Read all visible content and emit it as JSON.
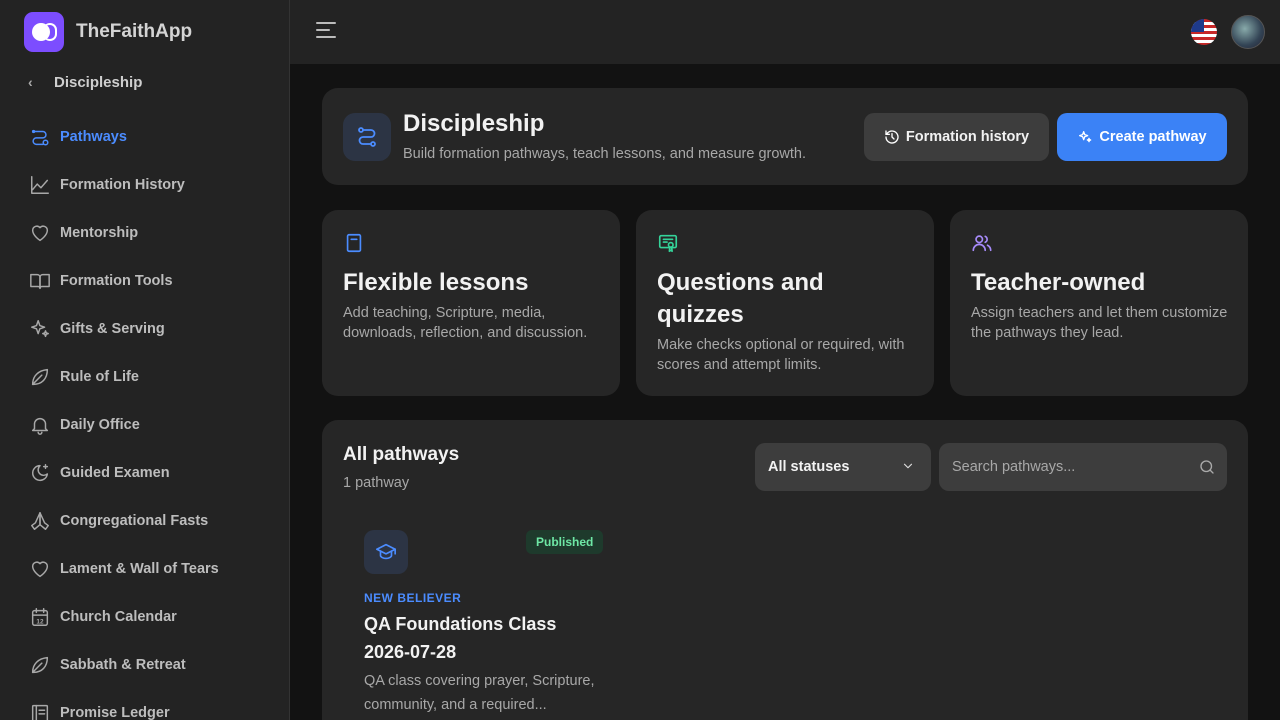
{
  "app": {
    "name": "TheFaithApp"
  },
  "sidebar": {
    "back_label": "Discipleship",
    "items": [
      {
        "label": "Pathways",
        "icon": "route-icon",
        "active": true
      },
      {
        "label": "Formation History",
        "icon": "chart-line-icon"
      },
      {
        "label": "Mentorship",
        "icon": "heart-icon"
      },
      {
        "label": "Formation Tools",
        "icon": "book-open-icon"
      },
      {
        "label": "Gifts & Serving",
        "icon": "sparkles-icon"
      },
      {
        "label": "Rule of Life",
        "icon": "leaf-icon"
      },
      {
        "label": "Daily Office",
        "icon": "bell-icon"
      },
      {
        "label": "Guided Examen",
        "icon": "moon-star-icon"
      },
      {
        "label": "Congregational Fasts",
        "icon": "praying-hands-icon"
      },
      {
        "label": "Lament & Wall of Tears",
        "icon": "heart-icon"
      },
      {
        "label": "Church Calendar",
        "icon": "calendar-icon"
      },
      {
        "label": "Sabbath & Retreat",
        "icon": "leaf-icon"
      },
      {
        "label": "Promise Ledger",
        "icon": "ledger-icon"
      }
    ],
    "calendar_day": "12"
  },
  "header": {
    "title": "Discipleship",
    "subtitle": "Build formation pathways, teach lessons, and measure growth.",
    "history_button": "Formation history",
    "create_button": "Create pathway"
  },
  "features": [
    {
      "title": "Flexible lessons",
      "description": "Add teaching, Scripture, media, downloads, reflection, and discussion.",
      "icon": "book-icon",
      "color": "#4b8cff"
    },
    {
      "title": "Questions and quizzes",
      "description": "Make checks optional or required, with scores and attempt limits.",
      "icon": "certificate-icon",
      "color": "#34d399"
    },
    {
      "title": "Teacher-owned",
      "description": "Assign teachers and let them customize the pathways they lead.",
      "icon": "users-icon",
      "color": "#a78bfa"
    }
  ],
  "pathways_list": {
    "title": "All pathways",
    "count": "1 pathway",
    "status_filter": "All statuses",
    "search_placeholder": "Search pathways...",
    "items": [
      {
        "status": "Published",
        "category": "NEW BELIEVER",
        "title": "QA Foundations Class 2026-07-28",
        "description": "QA class covering prayer, Scripture, community, and a required..."
      }
    ]
  },
  "colors": {
    "accent": "#3b82f6",
    "background": "#121212",
    "card": "#262626",
    "sidebar": "#232323",
    "success": "#6ee7a5"
  }
}
